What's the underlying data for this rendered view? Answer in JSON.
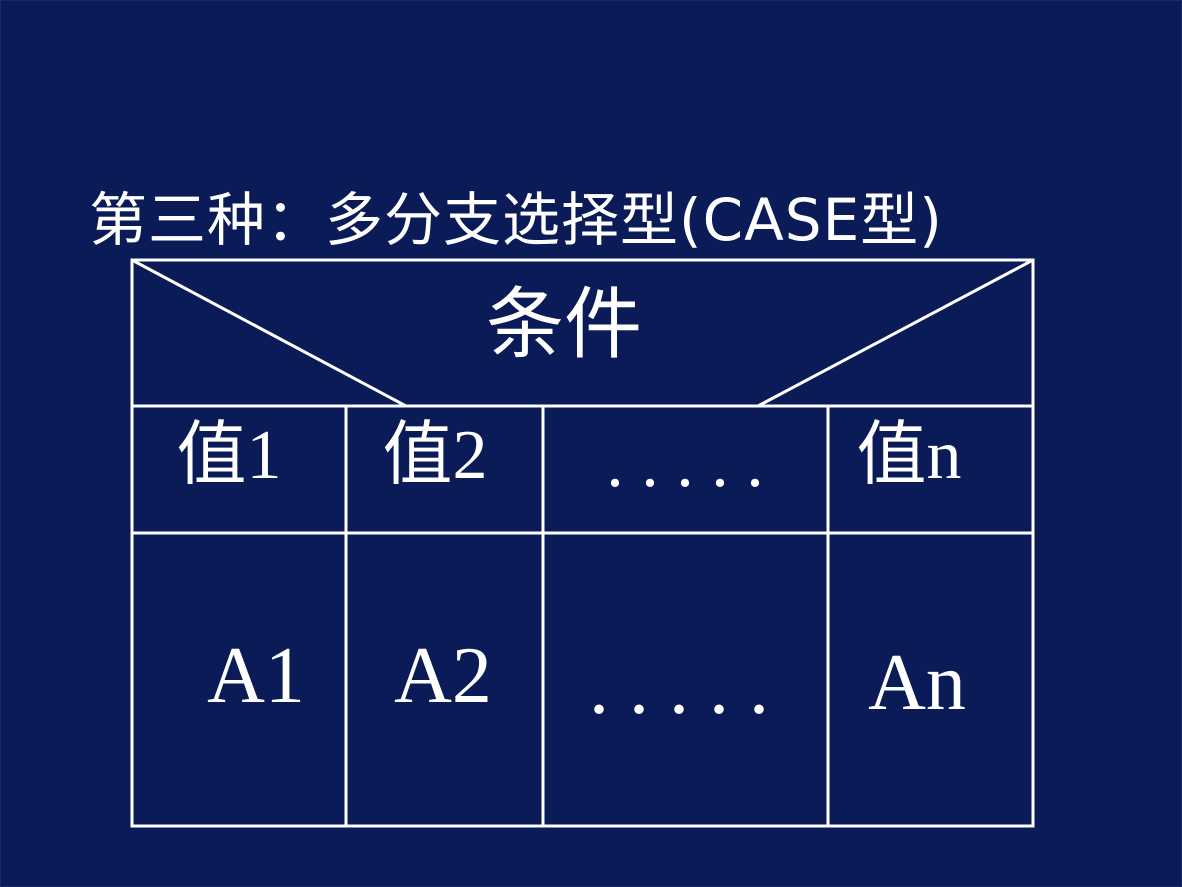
{
  "slide": {
    "title": "第三种：多分支选择型(CASE型)",
    "background_color": "#0a1b58",
    "line_color": "#ffffff"
  },
  "diagram": {
    "condition_label": "条件",
    "values": [
      "值1",
      "值2",
      ". . . . .",
      "值n"
    ],
    "actions": [
      "A1",
      "A2",
      ". . . . .",
      "An"
    ]
  }
}
